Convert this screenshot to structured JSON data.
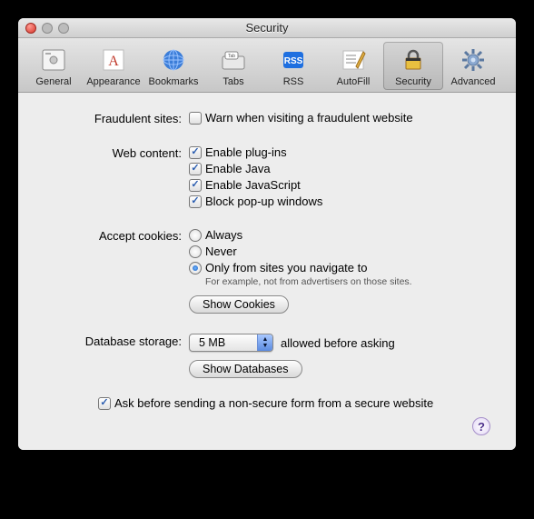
{
  "window": {
    "title": "Security"
  },
  "toolbar": {
    "items": [
      {
        "label": "General"
      },
      {
        "label": "Appearance"
      },
      {
        "label": "Bookmarks"
      },
      {
        "label": "Tabs"
      },
      {
        "label": "RSS"
      },
      {
        "label": "AutoFill"
      },
      {
        "label": "Security"
      },
      {
        "label": "Advanced"
      }
    ]
  },
  "sections": {
    "fraud": {
      "label": "Fraudulent sites:",
      "warn": "Warn when visiting a fraudulent website"
    },
    "webcontent": {
      "label": "Web content:",
      "plugins": "Enable plug-ins",
      "java": "Enable Java",
      "javascript": "Enable JavaScript",
      "popup": "Block pop-up windows"
    },
    "cookies": {
      "label": "Accept cookies:",
      "always": "Always",
      "never": "Never",
      "only": "Only from sites you navigate to",
      "hint": "For example, not from advertisers on those sites.",
      "show": "Show Cookies"
    },
    "db": {
      "label": "Database storage:",
      "value": "5 MB",
      "suffix": "allowed before asking",
      "show": "Show Databases"
    },
    "nonsecure": "Ask before sending a non-secure form from a secure website"
  }
}
